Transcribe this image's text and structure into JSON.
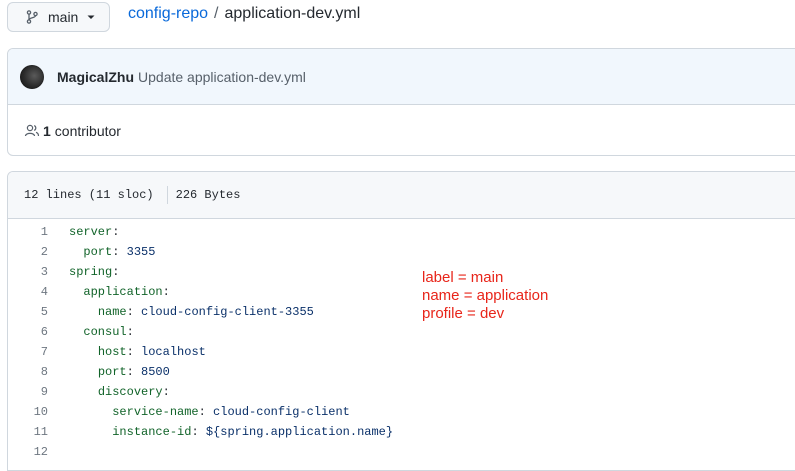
{
  "branch": {
    "name": "main"
  },
  "breadcrumb": {
    "repo": "config-repo",
    "separator": "/",
    "file": "application-dev.yml"
  },
  "commit": {
    "author": "MagicalZhu",
    "message": "Update application-dev.yml"
  },
  "contributors": {
    "count": "1",
    "label": "contributor"
  },
  "file_info": {
    "lines": "12 lines (11 sloc)",
    "size": "226 Bytes"
  },
  "code": {
    "lines": [
      {
        "num": "1",
        "indent": "",
        "key": "server",
        "colon": ":",
        "value": ""
      },
      {
        "num": "2",
        "indent": "  ",
        "key": "port",
        "colon": ":",
        "value": " 3355"
      },
      {
        "num": "3",
        "indent": "",
        "key": "spring",
        "colon": ":",
        "value": ""
      },
      {
        "num": "4",
        "indent": "  ",
        "key": "application",
        "colon": ":",
        "value": ""
      },
      {
        "num": "5",
        "indent": "    ",
        "key": "name",
        "colon": ":",
        "value": " cloud-config-client-3355"
      },
      {
        "num": "6",
        "indent": "  ",
        "key": "consul",
        "colon": ":",
        "value": ""
      },
      {
        "num": "7",
        "indent": "    ",
        "key": "host",
        "colon": ":",
        "value": " localhost"
      },
      {
        "num": "8",
        "indent": "    ",
        "key": "port",
        "colon": ":",
        "value": " 8500"
      },
      {
        "num": "9",
        "indent": "    ",
        "key": "discovery",
        "colon": ":",
        "value": ""
      },
      {
        "num": "10",
        "indent": "      ",
        "key": "service-name",
        "colon": ":",
        "value": " cloud-config-client"
      },
      {
        "num": "11",
        "indent": "      ",
        "key": "instance-id",
        "colon": ":",
        "value": " ${spring.application.name}"
      },
      {
        "num": "12",
        "indent": "",
        "key": "",
        "colon": "",
        "value": ""
      }
    ]
  },
  "annotation": {
    "lines": [
      "label = main",
      "name = application",
      "profile = dev"
    ],
    "color": "#e8251a"
  },
  "icons": {
    "branch": "git-branch-icon",
    "caret": "caret-down-icon",
    "people": "people-icon"
  },
  "colors": {
    "link": "#0969da",
    "yaml_key": "#116329",
    "yaml_value": "#0a3069"
  }
}
